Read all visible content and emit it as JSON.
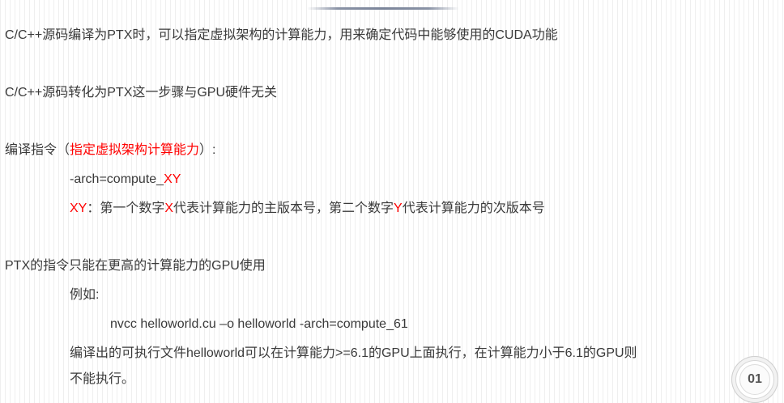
{
  "lines": {
    "l1": "C/C++源码编译为PTX时，可以指定虚拟架构的计算能力，用来确定代码中能够使用的CUDA功能",
    "l2": "C/C++源码转化为PTX这一步骤与GPU硬件无关",
    "l3_a": "编译指令（",
    "l3_b": "指定虚拟架构计算能力",
    "l3_c": "）:",
    "l4_a": "-arch=compute_",
    "l4_b": "XY",
    "l5_a": "XY",
    "l5_b": "：第一个数字",
    "l5_c": "X",
    "l5_d": "代表计算能力的主版本号，第二个数字",
    "l5_e": "Y",
    "l5_f": "代表计算能力的次版本号",
    "l6": "PTX的指令只能在更高的计算能力的GPU使用",
    "l7": "例如:",
    "l8": "nvcc helloworld.cu –o helloworld  -arch=compute_61",
    "l9": "编译出的可执行文件helloworld可以在计算能力>=6.1的GPU上面执行，在计算能力小于6.1的GPU则",
    "l10": "不能执行。"
  },
  "page_number": "01",
  "colors": {
    "text": "#3a3a3a",
    "highlight": "#ff0000"
  }
}
